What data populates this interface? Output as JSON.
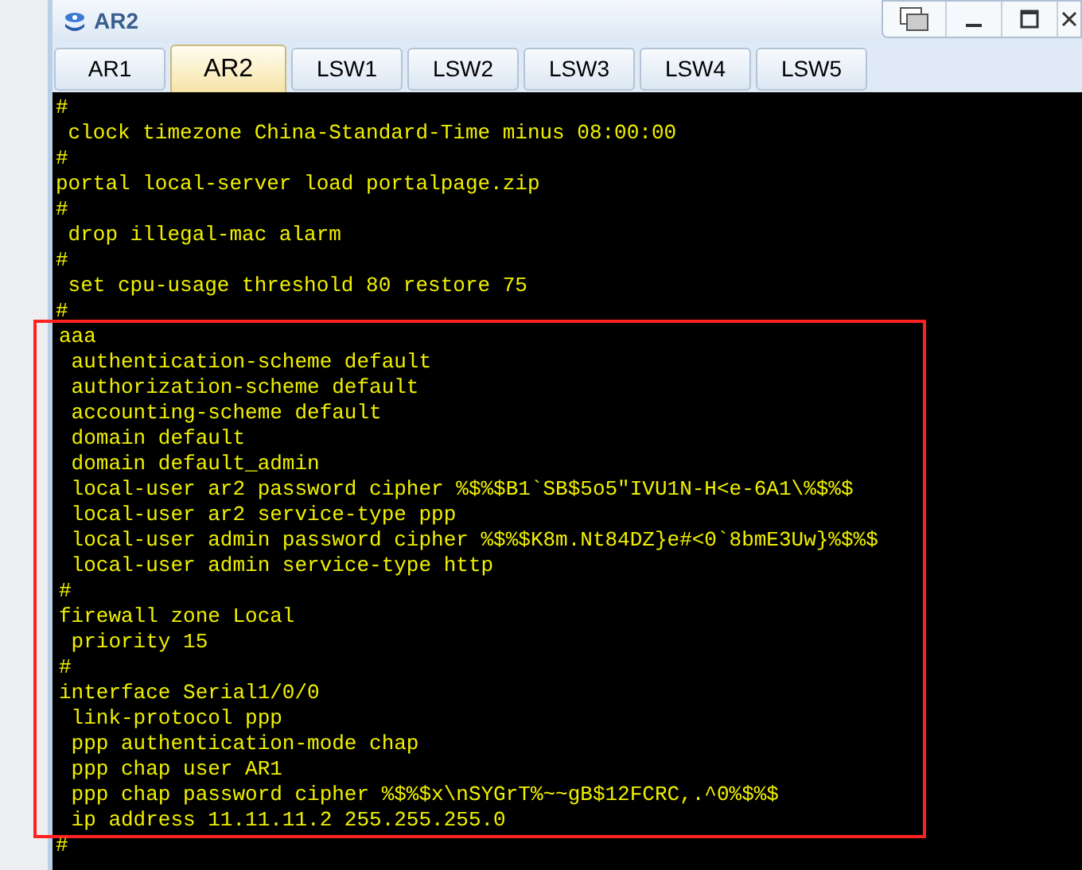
{
  "window": {
    "title": "AR2"
  },
  "tabs": [
    {
      "label": "AR1",
      "selected": false
    },
    {
      "label": "AR2",
      "selected": true
    },
    {
      "label": "LSW1",
      "selected": false
    },
    {
      "label": "LSW2",
      "selected": false
    },
    {
      "label": "LSW3",
      "selected": false
    },
    {
      "label": "LSW4",
      "selected": false
    },
    {
      "label": "LSW5",
      "selected": false
    }
  ],
  "console": {
    "lines": [
      {
        "text": "#",
        "highlighted": false
      },
      {
        "text": " clock timezone China-Standard-Time minus 08:00:00",
        "highlighted": false
      },
      {
        "text": "#",
        "highlighted": false
      },
      {
        "text": "portal local-server load portalpage.zip",
        "highlighted": false
      },
      {
        "text": "#",
        "highlighted": false
      },
      {
        "text": " drop illegal-mac alarm",
        "highlighted": false
      },
      {
        "text": "#",
        "highlighted": false
      },
      {
        "text": " set cpu-usage threshold 80 restore 75",
        "highlighted": false
      },
      {
        "text": "#",
        "highlighted": false
      },
      {
        "text": "aaa",
        "highlighted": true
      },
      {
        "text": " authentication-scheme default",
        "highlighted": true
      },
      {
        "text": " authorization-scheme default",
        "highlighted": true
      },
      {
        "text": " accounting-scheme default",
        "highlighted": true
      },
      {
        "text": " domain default",
        "highlighted": true
      },
      {
        "text": " domain default_admin",
        "highlighted": true
      },
      {
        "text": " local-user ar2 password cipher %$%$B1`SB$5o5\"IVU1N-H<e-6A1\\%$%$",
        "highlighted": true
      },
      {
        "text": " local-user ar2 service-type ppp",
        "highlighted": true
      },
      {
        "text": " local-user admin password cipher %$%$K8m.Nt84DZ}e#<0`8bmE3Uw}%$%$",
        "highlighted": true
      },
      {
        "text": " local-user admin service-type http",
        "highlighted": true
      },
      {
        "text": "#",
        "highlighted": true
      },
      {
        "text": "firewall zone Local",
        "highlighted": true
      },
      {
        "text": " priority 15",
        "highlighted": true
      },
      {
        "text": "#",
        "highlighted": true
      },
      {
        "text": "interface Serial1/0/0",
        "highlighted": true
      },
      {
        "text": " link-protocol ppp",
        "highlighted": true
      },
      {
        "text": " ppp authentication-mode chap",
        "highlighted": true
      },
      {
        "text": " ppp chap user AR1",
        "highlighted": true
      },
      {
        "text": " ppp chap password cipher %$%$x\\nSYGrT%~~gB$12FCRC,.^0%$%$",
        "highlighted": true
      },
      {
        "text": " ip address 11.11.11.2 255.255.255.0",
        "highlighted": true
      },
      {
        "text": "#",
        "highlighted": false
      }
    ]
  }
}
